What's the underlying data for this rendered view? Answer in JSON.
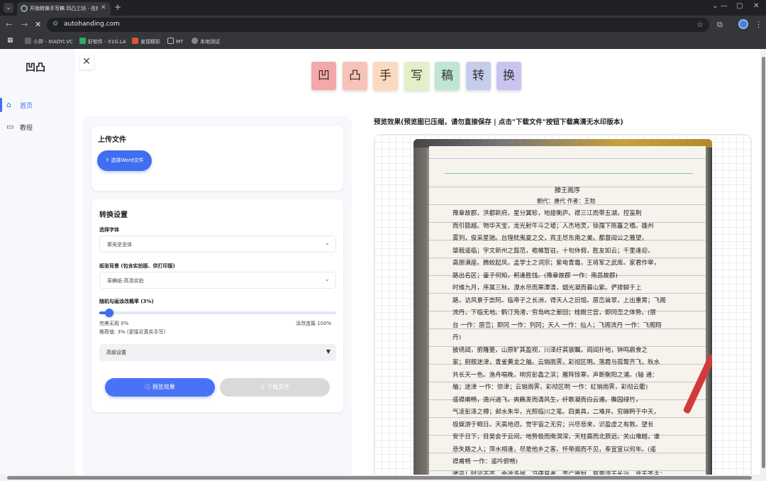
{
  "browser": {
    "tab_title": "开始转换手写稿 凹凸工坊 - 在线",
    "url": "autohanding.com",
    "bookmarks": [
      "小羿 - XIAOYI.VC",
      "好软件 - X1G.LA",
      "发现精彩",
      "MT",
      "本地测试"
    ]
  },
  "sidebar": {
    "logo": "凹凸",
    "items": [
      {
        "label": "首页",
        "icon": "home-icon",
        "active": true
      },
      {
        "label": "教程",
        "icon": "book-icon",
        "active": false
      }
    ]
  },
  "header": {
    "title_chars": [
      "凹",
      "凸",
      "手",
      "写",
      "稿",
      "转",
      "换"
    ],
    "title_colors": [
      "#f4a8aa",
      "#f7c2b8",
      "#fbd9bf",
      "#e3efc6",
      "#bfe6d3",
      "#c5cdea",
      "#c8c4ef"
    ]
  },
  "upload": {
    "title": "上传文件",
    "button_label": "选择Word文件"
  },
  "settings": {
    "title": "转换设置",
    "font_label": "选择字体",
    "font_value": "栗壳坚坚体",
    "bg_label": "纸张背景 (包含实拍版、供打印版)",
    "bg_value": "草稿纸-高清实拍",
    "prob_label": "随机勾画涂改概率 (3%)",
    "prob_value": 0.03,
    "min_label": "完美无瑕 0%",
    "max_label": "涂改连篇 100%",
    "recommend": "推荐值: 3% (更接近真实手写)",
    "advanced_label": "高级设置"
  },
  "actions": {
    "preview_label": "预览效果",
    "download_label": "下载文件"
  },
  "preview": {
    "title": "预览效果(预览图已压缩，请勿直接保存 | 点击\"下载文件\"按钮下载高清无水印版本)",
    "doc_title": "滕王阁序",
    "doc_sub": "朝代：唐代 作者：王勃",
    "lines": [
      "豫章故郡，洪都新府。星分翼轸，地接衡庐。襟三江而带五湖，控蛮荆",
      "而引瓯越。物华天宝，龙光射牛斗之墟；人杰地灵，徐孺下陈蕃之榻。雄州",
      "雾列，俊采星驰。台隍枕夷夏之交，宾主尽东南之美。都督阎公之雅望，",
      "棨戟遥临；宇文新州之懿范，襜帷暂驻。十旬休假，胜友如云；千里逢迎，",
      "高朋满座。腾蛟起凤，孟学士之词宗；紫电青霜，王将军之武库。家君作宰，",
      "路出名区；童子何知，躬逢胜饯。(豫章故郡 一作：南昌故郡)",
      "时维九月，序属三秋。潦水尽而寒潭清，烟光凝而暮山紫。俨骖騑于上",
      "路，访风景于崇阿。临帝子之长洲，得天人之旧馆。层峦耸翠，上出重霄；飞阁",
      "流丹，下临无地。鹤汀凫渚，穷岛屿之萦回；桂殿兰宫，即冈峦之体势。(层",
      "台 一作：层峦；即冈 一作：列冈；天人 一作：仙人；飞阁流丹 一作：飞阁翔",
      "丹)",
      "披绣闼，俯雕甍，山原旷其盈视，川泽纡其骇瞩。闾阎扑地，钟鸣鼎食之",
      "家；舸舰迷津，青雀黄龙之舳。云销雨霁，彩彻区明。落霞与孤鹜齐飞，秋水",
      "共长天一色。渔舟唱晚，响穷彭蠡之滨；雁阵惊寒，声断衡阳之浦。(轴 通：",
      "舳；迷津 一作：弥津；云销雨霁，彩彻区明 一作：虹销雨霁，彩彻云衢)",
      "遥襟甫畅，逸兴遄飞。爽籁发而清风生，纤歌凝而白云遏。睢园绿竹，",
      "气凌彭泽之樽；邺水朱华，光照临川之笔。四美具，二难并。穷睇眄于中天，",
      "极娱游于暇日。天高地迥，觉宇宙之无穷；兴尽悲来，识盈虚之有数。望长",
      "安于日下，目吴会于云间。地势极而南溟深，天柱高而北辰远。关山难越，谁",
      "悲失路之人；萍水相逢，尽是他乡之客。怀帝阍而不见，奉宣室以何年。(遥",
      "襟甫畅 一作：遥吟俯畅)",
      "嗟乎！时运不齐，命途多舛。冯唐易老，李广难封。屈贾谊于长沙，非无圣主；"
    ]
  }
}
